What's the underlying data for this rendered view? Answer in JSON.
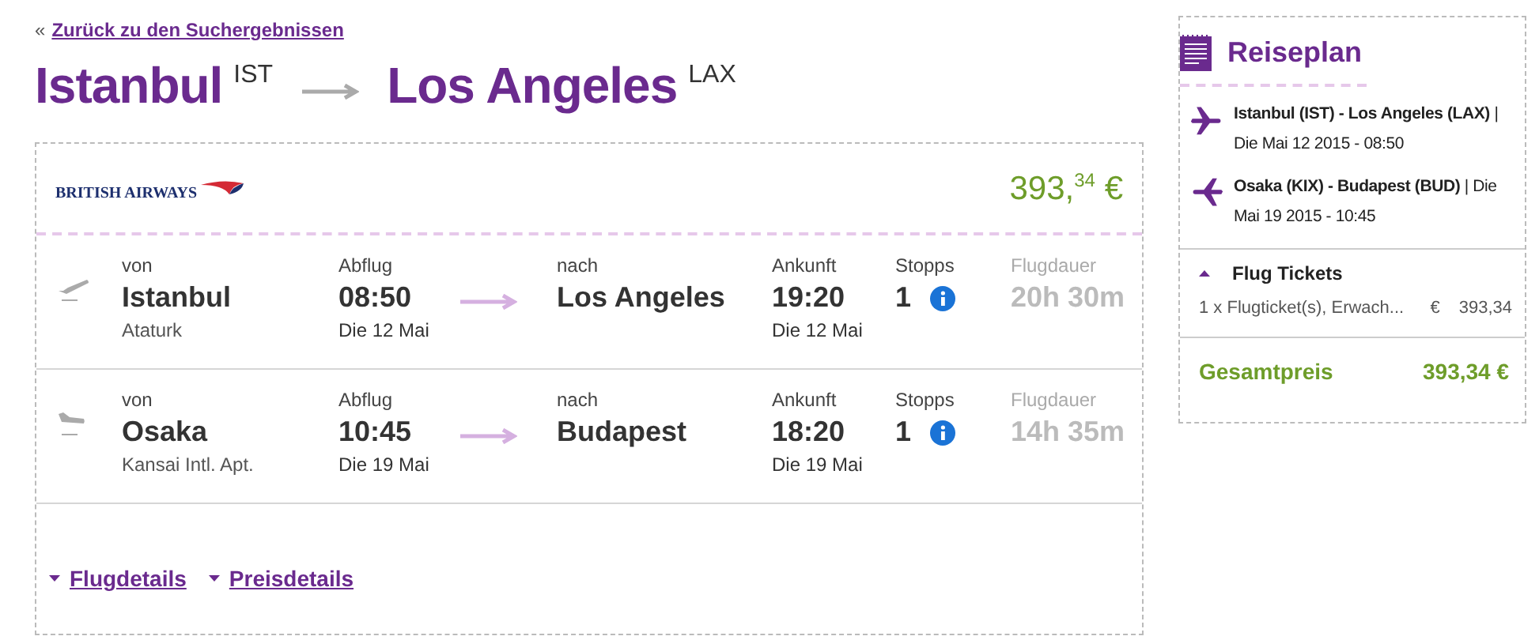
{
  "back_link": {
    "prefix": "«",
    "label": "Zurück zu den Suchergebnissen"
  },
  "route": {
    "from_city": "Istanbul",
    "from_code": "IST",
    "to_city": "Los Angeles",
    "to_code": "LAX"
  },
  "offer": {
    "airline": "BRITISH AIRWAYS",
    "price": "393,$^{34}$ €",
    "flights": [
      {
        "kind": "outbound",
        "from_label": "von",
        "from_city": "Istanbul",
        "from_airport": "Ataturk",
        "dep_label": "Abflug",
        "dep_time": "08:50",
        "dep_date": "Die 12 Mai",
        "to_label": "nach",
        "to_city": "Los Angeles",
        "arr_label": "Ankunft",
        "arr_time": "19:20",
        "arr_date": "Die 12 Mai",
        "stops_label": "Stopps",
        "stops": "1",
        "duration_label": "Flugdauer",
        "duration": "20h 30m"
      },
      {
        "kind": "return",
        "from_label": "von",
        "from_city": "Osaka",
        "from_airport": "Kansai Intl. Apt.",
        "dep_label": "Abflug",
        "dep_time": "10:45",
        "dep_date": "Die 19 Mai",
        "to_label": "nach",
        "to_city": "Budapest",
        "arr_label": "Ankunft",
        "arr_time": "18:20",
        "arr_date": "Die 19 Mai",
        "stops_label": "Stopps",
        "stops": "1",
        "duration_label": "Flugdauer",
        "duration": "14h 35m"
      }
    ],
    "links": [
      "Flugdetails",
      "Preisdetails"
    ]
  },
  "itinerary": {
    "title": "Reiseplan",
    "legs": [
      {
        "kind": "outbound",
        "text": "**Istanbul (IST) - Los Angeles (LAX)** | Die Mai 12 2015 - 08:50"
      },
      {
        "kind": "return",
        "text": "**Osaka (KIX) - Budapest (BUD)** | Die Mai 19 2015 - 10:45"
      }
    ],
    "tickets": {
      "title": "Flug Tickets",
      "expanded": true,
      "item": "1 x Flugticket(s), Erwach...",
      "currency": "€",
      "amount": "393,34"
    },
    "total_label": "Gesamtpreis",
    "total": "393,34 €"
  }
}
